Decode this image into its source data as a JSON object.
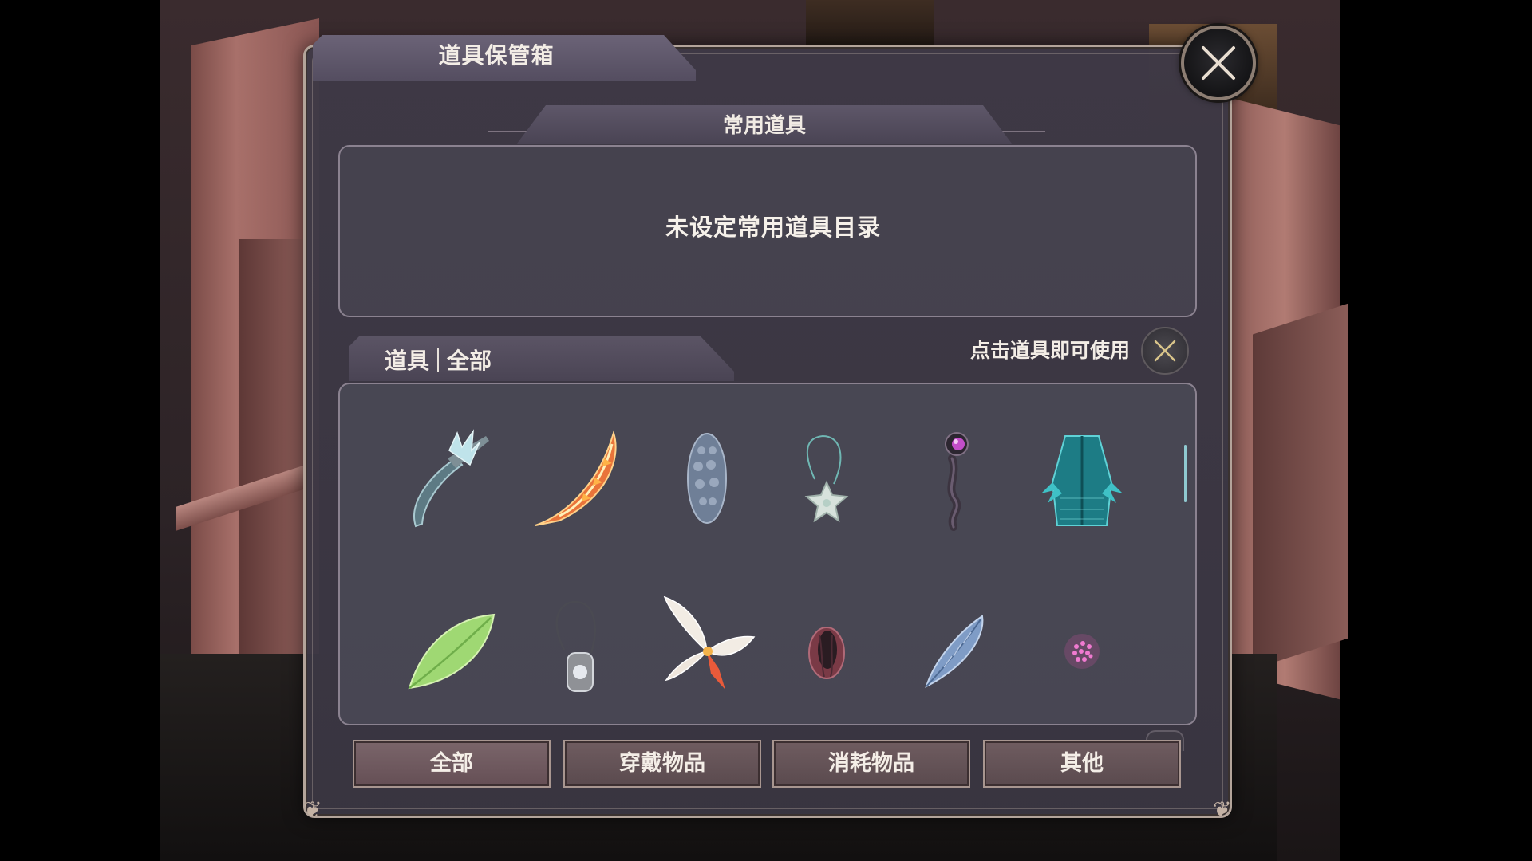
{
  "window": {
    "title": "道具保管箱",
    "close_icon": "close-x-icon"
  },
  "common": {
    "header": "常用道具",
    "empty_text": "未设定常用道具目录"
  },
  "items": {
    "tab_label_left": "道具",
    "tab_label_right": "全部",
    "hint": "点击道具即可使用",
    "hint_icon": "toggle-x-icon",
    "grid": [
      {
        "icon": "scythe-icon"
      },
      {
        "icon": "flame-blade-icon"
      },
      {
        "icon": "spiked-shell-icon"
      },
      {
        "icon": "star-pendant-icon"
      },
      {
        "icon": "orb-staff-icon"
      },
      {
        "icon": "teal-robe-icon"
      },
      {
        "icon": "green-leaf-icon"
      },
      {
        "icon": "silver-amulet-icon"
      },
      {
        "icon": "flower-petal-icon"
      },
      {
        "icon": "dark-seed-icon"
      },
      {
        "icon": "blue-feather-icon"
      },
      {
        "icon": "pink-sparkle-icon"
      }
    ]
  },
  "categories": [
    {
      "label": "全部",
      "active": true
    },
    {
      "label": "穿戴物品",
      "active": false
    },
    {
      "label": "消耗物品",
      "active": false
    },
    {
      "label": "其他",
      "active": false
    }
  ],
  "colors": {
    "panel_bg": "#3e3946",
    "panel_border": "#b3a49a",
    "text": "#f3ede6",
    "button_bg": "#6f5c60"
  }
}
